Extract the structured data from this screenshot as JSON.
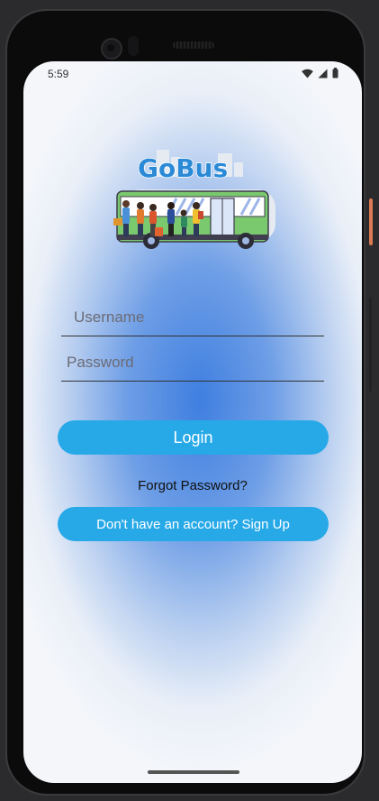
{
  "status_bar": {
    "time": "5:59",
    "icons": [
      "wifi-icon",
      "signal-icon",
      "battery-icon"
    ]
  },
  "logo": {
    "text": "GoBus",
    "color": "#2a8ad6"
  },
  "login_form": {
    "username_placeholder": "Username",
    "password_placeholder": "Password",
    "login_label": "Login",
    "forgot_label": "Forgot Password?",
    "signup_label": "Don't have an account? Sign Up"
  },
  "colors": {
    "accent": "#27a9e8",
    "bus_body": "#7bc96f",
    "gradient_center": "#3f7fe0"
  }
}
